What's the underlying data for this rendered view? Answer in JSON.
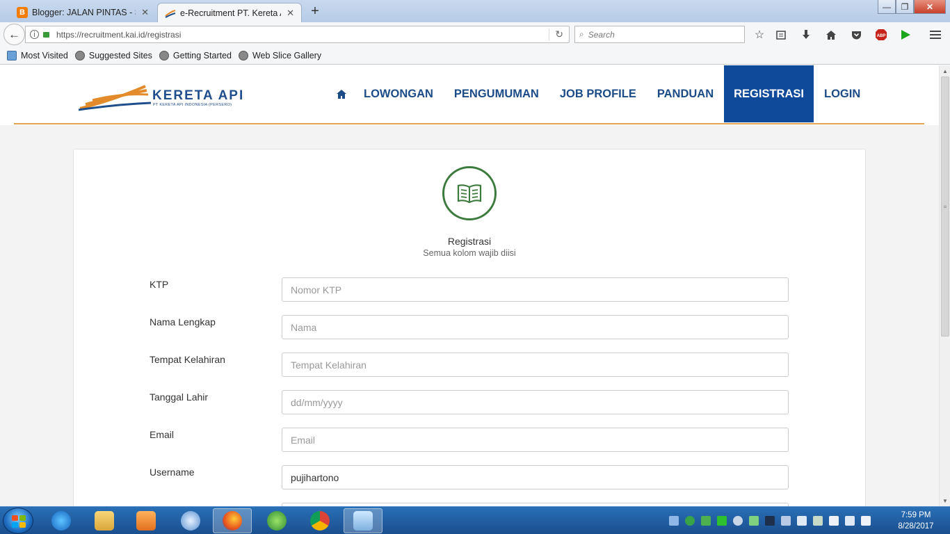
{
  "browser": {
    "tabs": [
      {
        "title": "Blogger: JALAN PINTAS - Ser",
        "favicon_color": "#f57d00",
        "active": false
      },
      {
        "title": "e-Recruitment PT. Kereta Api",
        "favicon_color": "#1e4e8c",
        "active": true
      }
    ],
    "new_tab": "+",
    "window": {
      "minimize": "—",
      "maximize": "❐",
      "close": "✕"
    },
    "back": "←",
    "url": "https://recruitment.kai.id/registrasi",
    "reload": "↻",
    "search_placeholder": "Search",
    "toolbar_icons": [
      "bookmark-star-icon",
      "reading-list-icon",
      "download-icon",
      "home-icon",
      "pocket-icon",
      "adblock-icon",
      "play-icon",
      "menu-icon"
    ],
    "bookmarks": [
      "Most Visited",
      "Suggested Sites",
      "Getting Started",
      "Web Slice Gallery"
    ]
  },
  "site": {
    "logo_text": "KERETA API",
    "logo_subtext": "PT KERETA API INDONESIA (PERSERO)",
    "nav": [
      {
        "label": "LOWONGAN"
      },
      {
        "label": "PENGUMUMAN"
      },
      {
        "label": "JOB PROFILE"
      },
      {
        "label": "PANDUAN"
      },
      {
        "label": "REGISTRASI",
        "active": true
      },
      {
        "label": "LOGIN"
      }
    ],
    "accent_color": "#0f4a9a",
    "rule_color": "#e0a44a"
  },
  "form": {
    "title": "Registrasi",
    "subtitle": "Semua kolom wajib diisi",
    "fields": [
      {
        "label": "KTP",
        "placeholder": "Nomor KTP",
        "value": ""
      },
      {
        "label": "Nama Lengkap",
        "placeholder": "Nama",
        "value": ""
      },
      {
        "label": "Tempat Kelahiran",
        "placeholder": "Tempat Kelahiran",
        "value": ""
      },
      {
        "label": "Tanggal Lahir",
        "placeholder": "dd/mm/yyyy",
        "value": ""
      },
      {
        "label": "Email",
        "placeholder": "Email",
        "value": ""
      },
      {
        "label": "Username",
        "placeholder": "",
        "value": "pujihartono"
      }
    ]
  },
  "taskbar": {
    "clock_time": "7:59 PM",
    "clock_date": "8/28/2017",
    "apps": [
      "internet-explorer",
      "file-explorer",
      "media-player",
      "cd-burner",
      "firefox",
      "green-app",
      "chrome",
      "paint"
    ]
  }
}
